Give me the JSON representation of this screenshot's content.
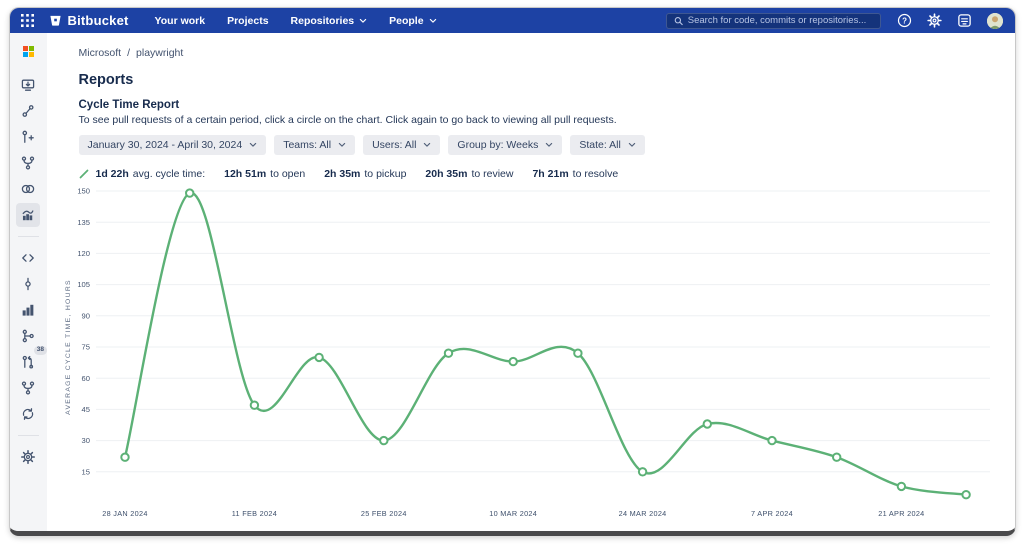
{
  "theme": {
    "navbar_bg": "#1d42a4",
    "line_green": "#5cb176",
    "sidebar_bg": "#f4f5f7",
    "text_navy": "#172b4d"
  },
  "navbar": {
    "brand": "Bitbucket",
    "links": [
      {
        "label": "Your work",
        "chevron": false
      },
      {
        "label": "Projects",
        "chevron": false
      },
      {
        "label": "Repositories",
        "chevron": true
      },
      {
        "label": "People",
        "chevron": true
      }
    ],
    "search": {
      "placeholder": "Search for code, commits or repositories..."
    },
    "right_icons": [
      "help-icon",
      "gear-icon",
      "feedback-icon",
      "avatar"
    ]
  },
  "sidebar": {
    "logo": "microsoft-logo",
    "groups": [
      {
        "items": [
          {
            "icon": "clone-monitor-icon"
          },
          {
            "icon": "commit-graph-icon"
          },
          {
            "icon": "pull-request-create-icon"
          },
          {
            "icon": "fork-icon"
          },
          {
            "icon": "overlap-circles-icon"
          },
          {
            "icon": "reports-chart-icon",
            "selected": true
          }
        ]
      },
      {
        "items": [
          {
            "icon": "code-icon"
          },
          {
            "icon": "commit-pole-icon"
          },
          {
            "icon": "bar-chart-icon"
          },
          {
            "icon": "branch-graph-icon"
          },
          {
            "icon": "pull-requests-icon",
            "badge": "38"
          },
          {
            "icon": "fork2-icon"
          },
          {
            "icon": "sync-icon"
          }
        ]
      },
      {
        "items": [
          {
            "icon": "settings-gear-icon"
          }
        ]
      }
    ]
  },
  "breadcrumb": {
    "items": [
      "Microsoft",
      "playwright"
    ],
    "separator": "/"
  },
  "page": {
    "title": "Reports",
    "report_title": "Cycle Time Report",
    "description": "To see pull requests of a certain period, click a circle on the chart. Click again to go back to viewing all pull requests."
  },
  "filters": [
    {
      "label": "January 30, 2024 - April 30, 2024"
    },
    {
      "label": "Teams: All"
    },
    {
      "label": "Users: All"
    },
    {
      "label": "Group by: Weeks"
    },
    {
      "label": "State: All"
    }
  ],
  "summary": {
    "icon": "trend-line-icon",
    "items": [
      {
        "value": "1d 22h",
        "label": "avg. cycle time:"
      },
      {
        "value": "12h 51m",
        "label": "to open"
      },
      {
        "value": "2h 35m",
        "label": "to pickup"
      },
      {
        "value": "20h 35m",
        "label": "to review"
      },
      {
        "value": "7h 21m",
        "label": "to resolve"
      }
    ]
  },
  "chart_data": {
    "type": "line",
    "title": "Cycle Time Report",
    "x": [
      "28 Jan 2024",
      "4 Feb 2024",
      "11 Feb 2024",
      "18 Feb 2024",
      "25 Feb 2024",
      "3 Mar 2024",
      "10 Mar 2024",
      "17 Mar 2024",
      "24 Mar 2024",
      "31 Mar 2024",
      "7 Apr 2024",
      "14 Apr 2024",
      "21 Apr 2024",
      "28 Apr 2024"
    ],
    "values": [
      22,
      149,
      47,
      70,
      30,
      72,
      68,
      72,
      15,
      38,
      30,
      22,
      8,
      4
    ],
    "series_name": "Average cycle time",
    "xlabel": "",
    "ylabel": "AVERAGE CYCLE TIME, HOURS",
    "x_tick_labels": [
      "28 JAN 2024",
      "11 FEB 2024",
      "25 FEB 2024",
      "10 MAR 2024",
      "24 MAR 2024",
      "7 APR 2024",
      "21 APR 2024"
    ],
    "x_tick_indices": [
      0,
      2,
      4,
      6,
      8,
      10,
      12
    ],
    "yticks": [
      15,
      30,
      45,
      60,
      75,
      90,
      105,
      120,
      135,
      150
    ],
    "ylim": [
      0,
      155
    ],
    "grid": true,
    "legend_position": "none",
    "line_color": "#5cb176",
    "point_style": "open-circle"
  }
}
